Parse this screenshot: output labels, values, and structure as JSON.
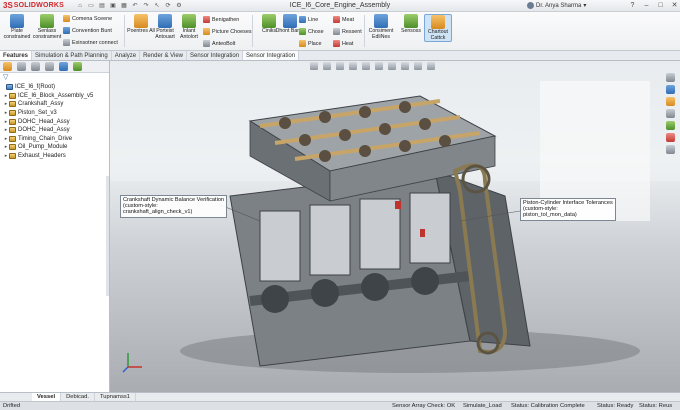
{
  "app": {
    "logo_text": "SOLIDWORKS",
    "document_title": "ICE_I6_Core_Engine_Assembly",
    "user_name": "Dr. Anya Sharma"
  },
  "ribbon": {
    "large_buttons": [
      {
        "label": "Plate constrained",
        "icon": "mate-icon"
      },
      {
        "label": "Senlass constrament",
        "icon": "smart-mate-icon"
      },
      {
        "label": "Poentres All",
        "icon": "components-icon"
      },
      {
        "label": "Porteist Antouart",
        "icon": "pattern-icon"
      },
      {
        "label": "Inlant Antolort",
        "icon": "insert-icon"
      },
      {
        "label": "Ciniks",
        "icon": "check-icon"
      },
      {
        "label": "Dhont Banet",
        "icon": "sheet-icon"
      },
      {
        "label": "Consiment EdliNes",
        "icon": "constraint-icon"
      },
      {
        "label": "Sensoss",
        "icon": "sensor-icon"
      },
      {
        "label": "Chartout Cattck",
        "icon": "chart-icon"
      }
    ],
    "small_group_a": [
      "Comena Sceene",
      "Convention Bunt",
      "Exinsotner connect"
    ],
    "small_group_b": [
      "Benigathen",
      "Picture Choeses",
      "AnteoBolt"
    ],
    "small_group_c": [
      "Line",
      "Chose",
      "Place"
    ],
    "small_group_d": [
      "Meat",
      "Ressent",
      "Heat"
    ]
  },
  "tabs": [
    "Features",
    "Simulation & Path Planning",
    "Analyze",
    "Render & View",
    "Sensor Integration",
    "Sensor Integration"
  ],
  "feature_tree": {
    "filter_icon": "filter-icon",
    "root": "ICE_I6_f(Root)",
    "items": [
      "ICE_I6_Block_Assembly_v5",
      "Crankshaft_Assy",
      "Piston_Set_v3",
      "DOHC_Head_Assy",
      "DOHC_Head_Assy",
      "Timing_Chain_Drive",
      "Oil_Pump_Module",
      "Exhaust_Headers"
    ]
  },
  "viewport": {
    "callouts": [
      {
        "title": "Crankshaft Dynamic Balance Verification",
        "line2": "(custom-style:",
        "line3": "crankshaft_align_check_v1)"
      },
      {
        "title": "Piston-Cylinder Interface Tolerances",
        "line2": "(custom-style:",
        "line3": "piston_tol_mon_data)"
      }
    ]
  },
  "bottom_tabs": [
    "Vessel",
    "Debicad.",
    "Tupnamss1"
  ],
  "status": {
    "left": "Drifted",
    "sensor": "Sensor Array Check: OK",
    "simulate": "Simulate_Load",
    "calibration": "Status: Calibration Complete",
    "ready": "Status: Ready",
    "reuse": "Status: Reus"
  }
}
